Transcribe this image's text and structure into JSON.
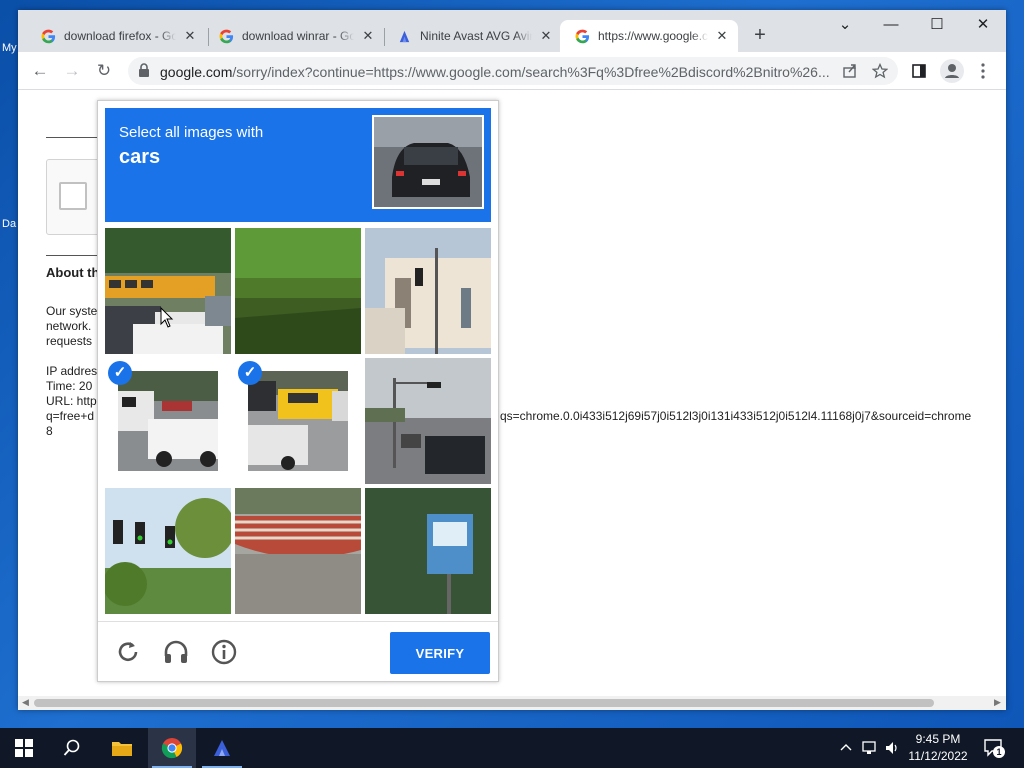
{
  "desktop": {
    "icons": [
      {
        "label": "My"
      },
      {
        "label": "Da"
      }
    ]
  },
  "browser": {
    "tabs": [
      {
        "title": "download firefox - Google Search",
        "favicon": "google-g-icon",
        "active": false
      },
      {
        "title": "download winrar - Google Search",
        "favicon": "google-g-icon",
        "active": false
      },
      {
        "title": "Ninite Avast AVG Avira",
        "favicon": "ninite-icon",
        "active": false
      },
      {
        "title": "https://www.google.com/sorry",
        "favicon": "google-g-icon",
        "active": true
      }
    ],
    "new_tab": "+",
    "controls": {
      "dropdown": "⌄",
      "minimize": "—",
      "maximize": "☐",
      "close": "✕"
    },
    "nav": {
      "back": "←",
      "forward": "→",
      "reload": "↻"
    },
    "url_host": "google.com",
    "url_rest": "/sorry/index?continue=https://www.google.com/search%3Fq%3Dfree%2Bdiscord%2Bnitro%26...",
    "toolbar_icons": [
      "share-icon",
      "bookmark-star-icon",
      "side-panel-icon",
      "profile-icon",
      "menu-icon"
    ]
  },
  "page": {
    "about_heading": "About th",
    "para1": [
      "Our syste",
      "network.",
      "requests"
    ],
    "para2": [
      "IP addres",
      "Time: 20",
      "URL: http",
      "q=free+d",
      "8"
    ],
    "url_tail": "qs=chrome.0.0i433i512j69i57j0i512l3j0i131i433i512j0i512l4.11168j0j7&sourceid=chrome"
  },
  "captcha": {
    "instruction": "Select all images with",
    "target": "cars",
    "tiles": [
      {
        "index": 0,
        "subject": "street-traffic-bus",
        "selected": false
      },
      {
        "index": 1,
        "subject": "crop-field",
        "selected": false
      },
      {
        "index": 2,
        "subject": "building-traffic-light",
        "selected": false
      },
      {
        "index": 3,
        "subject": "parked-cars",
        "selected": true
      },
      {
        "index": 4,
        "subject": "yellow-taxi",
        "selected": true
      },
      {
        "index": 5,
        "subject": "road-traffic-light",
        "selected": false
      },
      {
        "index": 6,
        "subject": "traffic-lights-trees",
        "selected": false
      },
      {
        "index": 7,
        "subject": "crosswalk-steps",
        "selected": false
      },
      {
        "index": 8,
        "subject": "bus-stop-sign",
        "selected": false
      }
    ],
    "footer_icons": [
      "reload-icon",
      "headphones-icon",
      "info-icon"
    ],
    "verify_label": "VERIFY"
  },
  "taskbar": {
    "apps": [
      "start-icon",
      "search-icon",
      "file-explorer-icon",
      "chrome-icon",
      "ninite-icon"
    ],
    "time": "9:45 PM",
    "date": "11/12/2022",
    "notifications": "1"
  },
  "colors": {
    "accent": "#1a73e8",
    "taskbar": "#101827"
  }
}
